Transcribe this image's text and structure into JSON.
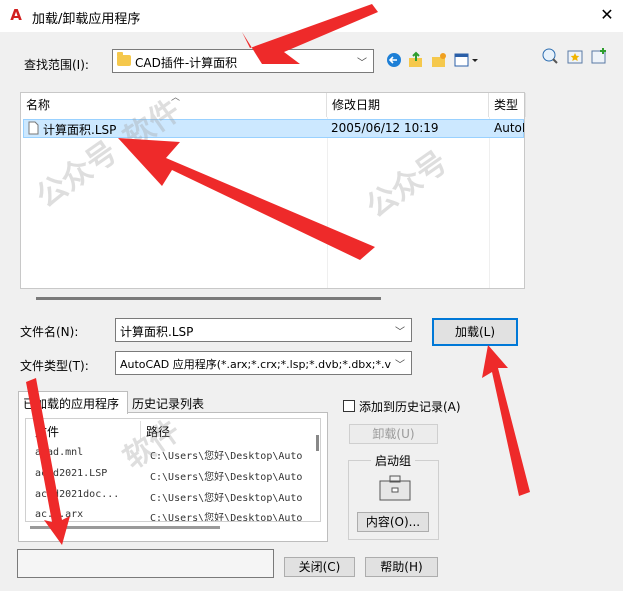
{
  "window": {
    "title": "加载/卸载应用程序",
    "app_icon": "A"
  },
  "lookin": {
    "label": "查找范围(I):",
    "value": "CAD插件-计算面积"
  },
  "filelist": {
    "columns": [
      "名称",
      "修改日期",
      "类型"
    ],
    "rows": [
      {
        "name": "计算面积.LSP",
        "date": "2005/06/12 10:19",
        "type": "AutoL"
      }
    ]
  },
  "filename": {
    "label": "文件名(N):",
    "value": "计算面积.LSP"
  },
  "filetype": {
    "label": "文件类型(T):",
    "value": "AutoCAD 应用程序(*.arx;*.crx;*.lsp;*.dvb;*.dbx;*.v"
  },
  "load_button": "加载(L)",
  "tabs": {
    "loaded": "已加载的应用程序",
    "history": "历史记录列表"
  },
  "loaded_table": {
    "columns": [
      "文件",
      "路径"
    ],
    "rows": [
      {
        "file": "acad.mnl",
        "path": "C:\\Users\\您好\\Desktop\\Auto"
      },
      {
        "file": "acad2021.LSP",
        "path": "C:\\Users\\您好\\Desktop\\Auto"
      },
      {
        "file": "acad2021doc...",
        "path": "C:\\Users\\您好\\Desktop\\Auto"
      },
      {
        "file": "ac...arx",
        "path": "C:\\Users\\您好\\Desktop\\Auto"
      }
    ]
  },
  "add_history": "添加到历史记录(A)",
  "unload_button": "卸载(U)",
  "startup": {
    "group_label": "启动组",
    "contents_button": "内容(O)..."
  },
  "close_button": "关闭(C)",
  "help_button": "帮助(H)",
  "watermark": [
    "公众号",
    "软件"
  ],
  "colors": {
    "accent": "#0078d7",
    "selection": "#cce8ff",
    "arrow": "#ee2a2a"
  }
}
